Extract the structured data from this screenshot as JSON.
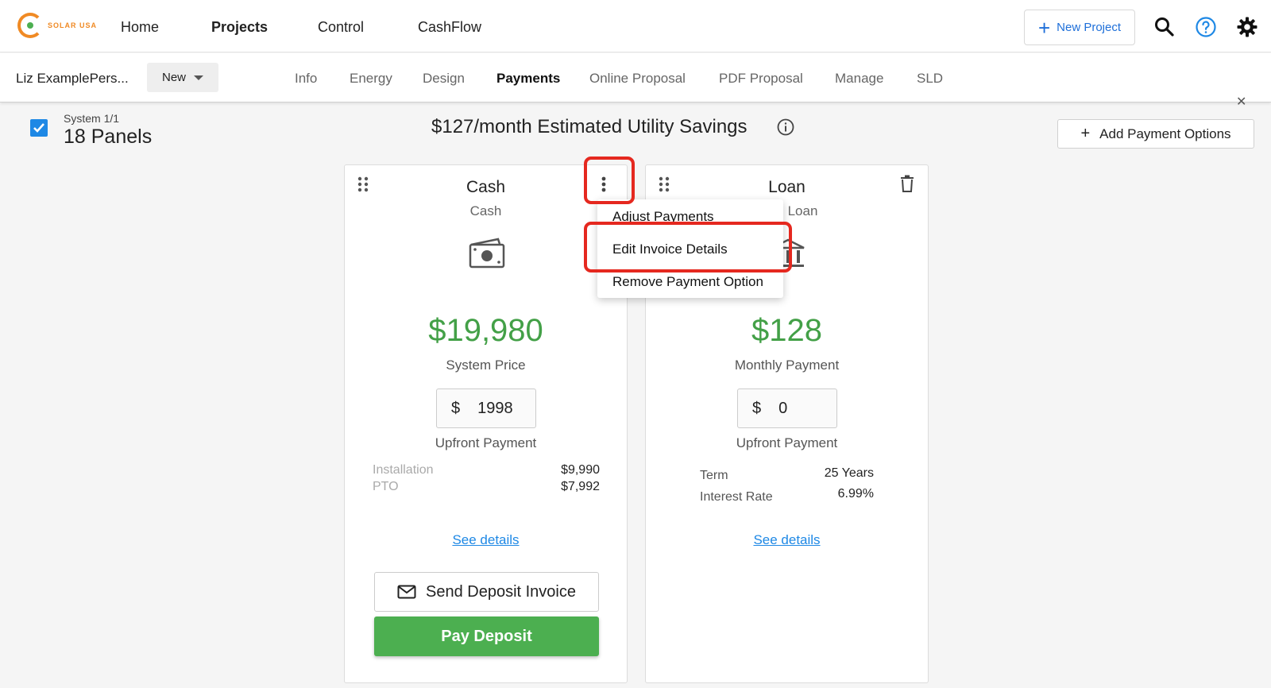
{
  "brand": {
    "logo_text": "SOLAR USA",
    "accent_color": "#f08a24"
  },
  "topnav": {
    "items": [
      {
        "label": "Home",
        "bold": false
      },
      {
        "label": "Projects",
        "bold": true
      },
      {
        "label": "Control",
        "bold": false
      },
      {
        "label": "CashFlow",
        "bold": false
      }
    ],
    "new_project_label": "New Project"
  },
  "subnav": {
    "customer_name": "Liz ExamplePers...",
    "status_value": "New",
    "tabs": [
      {
        "label": "Info",
        "active": false
      },
      {
        "label": "Energy",
        "active": false
      },
      {
        "label": "Design",
        "active": false
      },
      {
        "label": "Payments",
        "active": true
      },
      {
        "label": "Online Proposal",
        "active": false
      },
      {
        "label": "PDF Proposal",
        "active": false
      },
      {
        "label": "Manage",
        "active": false
      },
      {
        "label": "SLD",
        "active": false
      }
    ]
  },
  "system": {
    "label": "System 1/1",
    "panels": "18 Panels",
    "checked": true,
    "savings": "$127/month Estimated Utility Savings",
    "add_payment_label": "Add Payment Options"
  },
  "cards": {
    "cash": {
      "title": "Cash",
      "subtitle": "Cash",
      "price": "$19,980",
      "price_label": "System Price",
      "upfront_currency": "$",
      "upfront_value": "1998",
      "upfront_label": "Upfront Payment",
      "details": [
        {
          "label": "Installation",
          "value": "$9,990"
        },
        {
          "label": "PTO",
          "value": "$7,992"
        }
      ],
      "see_details": "See details",
      "send_invoice_label": "Send Deposit Invoice",
      "pay_deposit_label": "Pay Deposit"
    },
    "loan": {
      "title": "Loan",
      "subtitle": "Loan",
      "price": "$128",
      "price_label": "Monthly Payment",
      "upfront_currency": "$",
      "upfront_value": "0",
      "upfront_label": "Upfront Payment",
      "details": [
        {
          "label": "Term",
          "value": "25 Years"
        },
        {
          "label": "Interest Rate",
          "value": "6.99%"
        }
      ],
      "see_details": "See details"
    }
  },
  "menu": {
    "items": [
      {
        "label": "Adjust Payments"
      },
      {
        "label": "Edit Invoice Details"
      },
      {
        "label": "Remove Payment Option"
      }
    ]
  },
  "colors": {
    "price_green": "#43a047",
    "link_blue": "#1e88e5",
    "highlight_red": "#e5281f"
  }
}
